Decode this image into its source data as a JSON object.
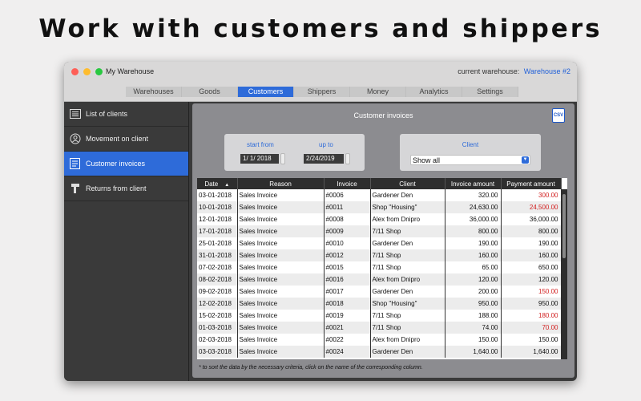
{
  "headline": "Work with customers and shippers",
  "window": {
    "title": "My Warehouse",
    "current_warehouse_label": "current warehouse:",
    "current_warehouse_value": "Warehouse #2"
  },
  "tabs": [
    {
      "label": "Warehouses",
      "active": false
    },
    {
      "label": "Goods",
      "active": false
    },
    {
      "label": "Customers",
      "active": true
    },
    {
      "label": "Shippers",
      "active": false
    },
    {
      "label": "Money",
      "active": false
    },
    {
      "label": "Analytics",
      "active": false
    },
    {
      "label": "Settings",
      "active": false
    }
  ],
  "sidebar": {
    "items": [
      {
        "label": "List of clients",
        "icon": "list-icon",
        "active": false
      },
      {
        "label": "Movement on client",
        "icon": "person-icon",
        "active": false
      },
      {
        "label": "Customer invoices",
        "icon": "invoice-icon",
        "active": true
      },
      {
        "label": "Returns from client",
        "icon": "return-icon",
        "active": false
      }
    ]
  },
  "panel": {
    "title": "Customer invoices",
    "csv_label": "CSV",
    "start_label": "start from",
    "start_value": "1/  1/ 2018",
    "end_label": "up to",
    "end_value": "2/24/2019",
    "client_label": "Client",
    "client_value": "Show all",
    "footnote": "* to sort the data by the necessary criteria, click on the name of the corresponding column."
  },
  "table": {
    "columns": [
      "Date",
      "Reason",
      "Invoice",
      "Client",
      "Invoice amount",
      "Payment amount"
    ],
    "sort_indicator": "▲",
    "rows": [
      [
        "03-01-2018",
        "Sales Invoice",
        "#0006",
        "Gardener Den",
        "320.00",
        "300.00"
      ],
      [
        "10-01-2018",
        "Sales Invoice",
        "#0011",
        "Shop \"Housing\"",
        "24,630.00",
        "24,500.00"
      ],
      [
        "12-01-2018",
        "Sales Invoice",
        "#0008",
        "Alex from Dnipro",
        "36,000.00",
        "36,000.00"
      ],
      [
        "17-01-2018",
        "Sales Invoice",
        "#0009",
        "7/11 Shop",
        "800.00",
        "800.00"
      ],
      [
        "25-01-2018",
        "Sales Invoice",
        "#0010",
        "Gardener Den",
        "190.00",
        "190.00"
      ],
      [
        "31-01-2018",
        "Sales Invoice",
        "#0012",
        "7/11 Shop",
        "160.00",
        "160.00"
      ],
      [
        "07-02-2018",
        "Sales Invoice",
        "#0015",
        "7/11 Shop",
        "65.00",
        "650.00"
      ],
      [
        "08-02-2018",
        "Sales Invoice",
        "#0016",
        "Alex from Dnipro",
        "120.00",
        "120.00"
      ],
      [
        "09-02-2018",
        "Sales Invoice",
        "#0017",
        "Gardener Den",
        "200.00",
        "150.00"
      ],
      [
        "12-02-2018",
        "Sales Invoice",
        "#0018",
        "Shop \"Housing\"",
        "950.00",
        "950.00"
      ],
      [
        "15-02-2018",
        "Sales Invoice",
        "#0019",
        "7/11 Shop",
        "188.00",
        "180.00"
      ],
      [
        "01-03-2018",
        "Sales Invoice",
        "#0021",
        "7/11 Shop",
        "74.00",
        "70.00"
      ],
      [
        "02-03-2018",
        "Sales Invoice",
        "#0022",
        "Alex from Dnipro",
        "150.00",
        "150.00"
      ],
      [
        "03-03-2018",
        "Sales Invoice",
        "#0024",
        "Gardener Den",
        "1,640.00",
        "1,640.00"
      ]
    ],
    "underpaid_rows": [
      0,
      1,
      8,
      10,
      11
    ]
  },
  "colors": {
    "accent": "#2e6bd9",
    "underpaid": "#d21f1f"
  }
}
